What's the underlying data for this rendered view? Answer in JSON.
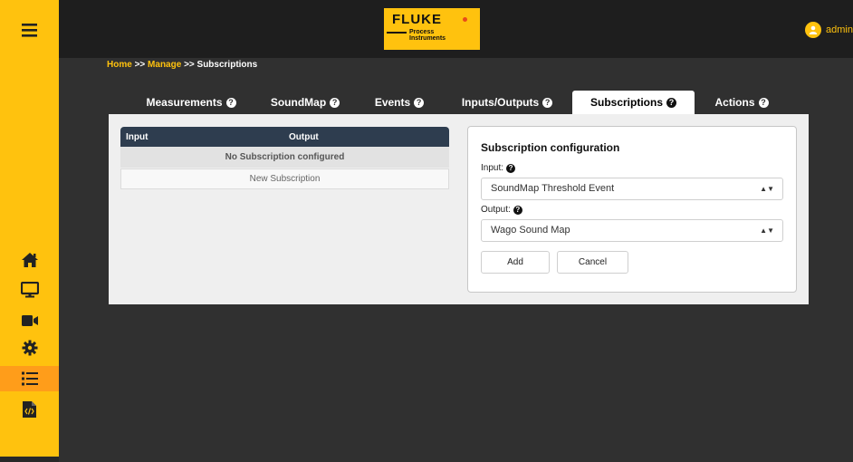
{
  "brand": {
    "logo_word": "FLUKE",
    "logo_sub_1": "Process",
    "logo_sub_2": "Instruments"
  },
  "user": {
    "name": "admin"
  },
  "breadcrumb": {
    "home": "Home",
    "sep": ">>",
    "manage": "Manage",
    "current": "Subscriptions"
  },
  "tabs": [
    {
      "label": "Measurements",
      "active": false
    },
    {
      "label": "SoundMap",
      "active": false
    },
    {
      "label": "Events",
      "active": false
    },
    {
      "label": "Inputs/Outputs",
      "active": false
    },
    {
      "label": "Subscriptions",
      "active": true
    },
    {
      "label": "Actions",
      "active": false
    }
  ],
  "table": {
    "col_input": "Input",
    "col_output": "Output",
    "empty_text": "No Subscription configured",
    "new_label": "New Subscription"
  },
  "config": {
    "title": "Subscription configuration",
    "input_label": "Input:",
    "input_value": "SoundMap Threshold Event",
    "output_label": "Output:",
    "output_value": "Wago Sound Map",
    "add_label": "Add",
    "cancel_label": "Cancel"
  },
  "colors": {
    "accent": "#ffc20e",
    "sidebar_active": "#ff9d1a",
    "table_header": "#2e3d4f",
    "background": "#303030"
  },
  "icons": {
    "menu": "hamburger-icon",
    "nav": [
      "home-icon",
      "monitor-icon",
      "video-camera-icon",
      "gear-icon",
      "list-icon",
      "code-file-icon"
    ],
    "user": "user-avatar-icon",
    "help": "question-circle-icon"
  }
}
